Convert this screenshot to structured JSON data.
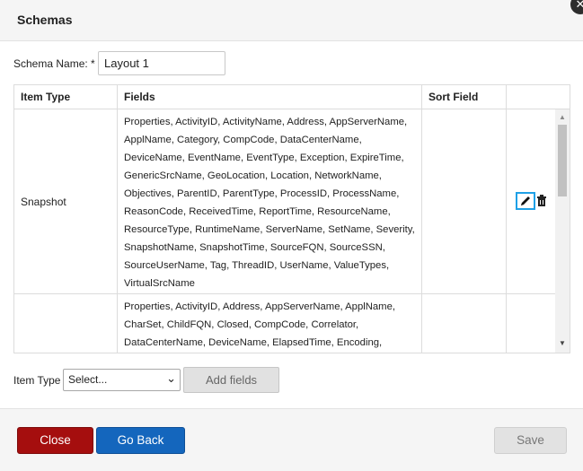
{
  "dialog": {
    "title": "Schemas",
    "close_icon": "close-icon"
  },
  "schema_name": {
    "label": "Schema Name: *",
    "value": "Layout 1"
  },
  "table": {
    "headers": [
      "Item Type",
      "Fields",
      "Sort Field",
      ""
    ],
    "rows": [
      {
        "item_type": "Snapshot",
        "fields": "Properties, ActivityID, ActivityName, Address, AppServerName, ApplName, Category, CompCode, DataCenterName, DeviceName, EventName, EventType, Exception, ExpireTime, GenericSrcName, GeoLocation, Location, NetworkName, Objectives, ParentID, ParentType, ProcessID, ProcessName, ReasonCode, ReceivedTime, ReportTime, ResourceName, ResourceType, RuntimeName, ServerName, SetName, Severity, SnapshotName, SnapshotTime, SourceFQN, SourceSSN, SourceUserName, Tag, ThreadID, UserName, ValueTypes, VirtualSrcName",
        "sort_field": "",
        "edit_icon": "pencil-icon",
        "delete_icon": "trash-icon"
      },
      {
        "item_type": "",
        "fields": "Properties, ActivityID, Address, AppServerName, ApplName, CharSet, ChildFQN, Closed, CompCode, Correlator, DataCenterName, DeviceName, ElapsedTime, Encoding,",
        "sort_field": ""
      }
    ]
  },
  "add_fields": {
    "label": "Item Type",
    "select_value": "Select...",
    "button_label": "Add fields"
  },
  "footer": {
    "close_label": "Close",
    "back_label": "Go Back",
    "save_label": "Save"
  },
  "colors": {
    "close_button": "#a50e0e",
    "back_button": "#1466bd",
    "edit_highlight": "#1ea0e6"
  }
}
